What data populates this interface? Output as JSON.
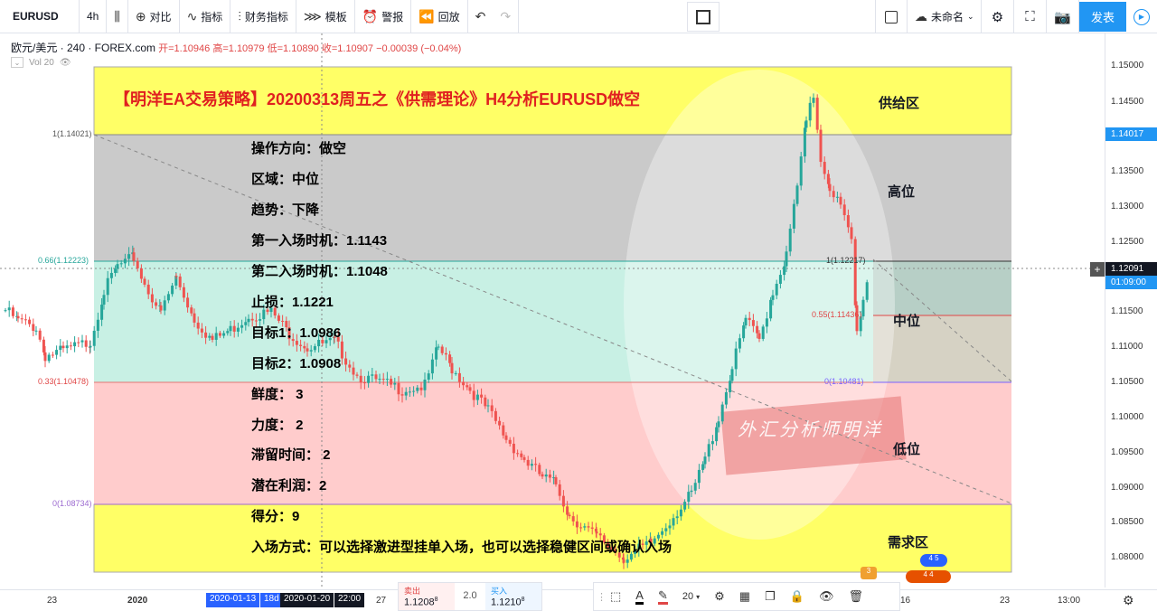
{
  "toolbar": {
    "symbol": "EURUSD",
    "interval": "4h",
    "compare": "对比",
    "indicators": "指标",
    "financials": "财务指标",
    "templates": "模板",
    "alerts": "警报",
    "replay": "回放",
    "layout_name": "未命名",
    "publish": "发表"
  },
  "legend": {
    "instrument": "欧元/美元 · 240 · FOREX.com",
    "open": "开=1.10946",
    "high": "高=1.10979",
    "low": "低=1.10890",
    "close": "收=1.10907",
    "change": "−0.00039 (−0.04%)",
    "volume": "Vol 20"
  },
  "title": "【明洋EA交易策略】20200313周五之《供需理论》H4分析EURUSD做空",
  "zones": {
    "supply": "供给区",
    "high": "高位",
    "middle": "中位",
    "low": "低位",
    "demand": "需求区"
  },
  "fib_labels": {
    "f1": "1(1.14021)",
    "f066": "0.66(1.12223)",
    "f033": "0.33(1.10478)",
    "f0": "0(1.08734)",
    "r1": "1(1.12217)",
    "r055": "0.55(1.11436)",
    "r0": "0(1.10481)"
  },
  "info": [
    "操作方向：做空",
    "区域：中位",
    "趋势：下降",
    "第一入场时机：1.1143",
    "第二入场时机：1.1048",
    "止损：1.1221",
    "目标1：1.0986",
    "目标2：1.0908",
    "鲜度： 3",
    "力度： 2",
    "滞留时间： 2",
    "潜在利润：2",
    "得分：9",
    "入场方式：可以选择激进型挂单入场，也可以选择稳健区间或确认入场"
  ],
  "price_axis": [
    "1.15000",
    "1.14500",
    "1.14017",
    "1.13500",
    "1.13000",
    "1.12500",
    "1.12091",
    "01:09:00",
    "1.11500",
    "1.11000",
    "1.10500",
    "1.10000",
    "1.09500",
    "1.09000",
    "1.08500",
    "1.08000"
  ],
  "time_axis": {
    "labels": [
      "23",
      "2020",
      "27",
      "16",
      "23",
      "13:00"
    ],
    "tags": [
      "2020-01-13",
      "18d",
      "2020-01-20",
      "22:00"
    ]
  },
  "trade": {
    "sell_label": "卖出",
    "sell_price": "1.1208",
    "sell_sup": "8",
    "spread": "2.0",
    "buy_label": "买入",
    "buy_price": "1.1210",
    "buy_sup": "8"
  },
  "drawing_bar": {
    "font_size": "20"
  },
  "watermark": "外汇分析师明洋",
  "colors": {
    "supply_zone": "#ffff66",
    "high_zone": "#bfbfbf",
    "mid_zone": "#c8f0e4",
    "low_zone": "#ffcccc",
    "up_candle": "#26a69a",
    "down_candle": "#ef5350",
    "publish": "#2196f3",
    "price_tag": "#2196f3"
  }
}
